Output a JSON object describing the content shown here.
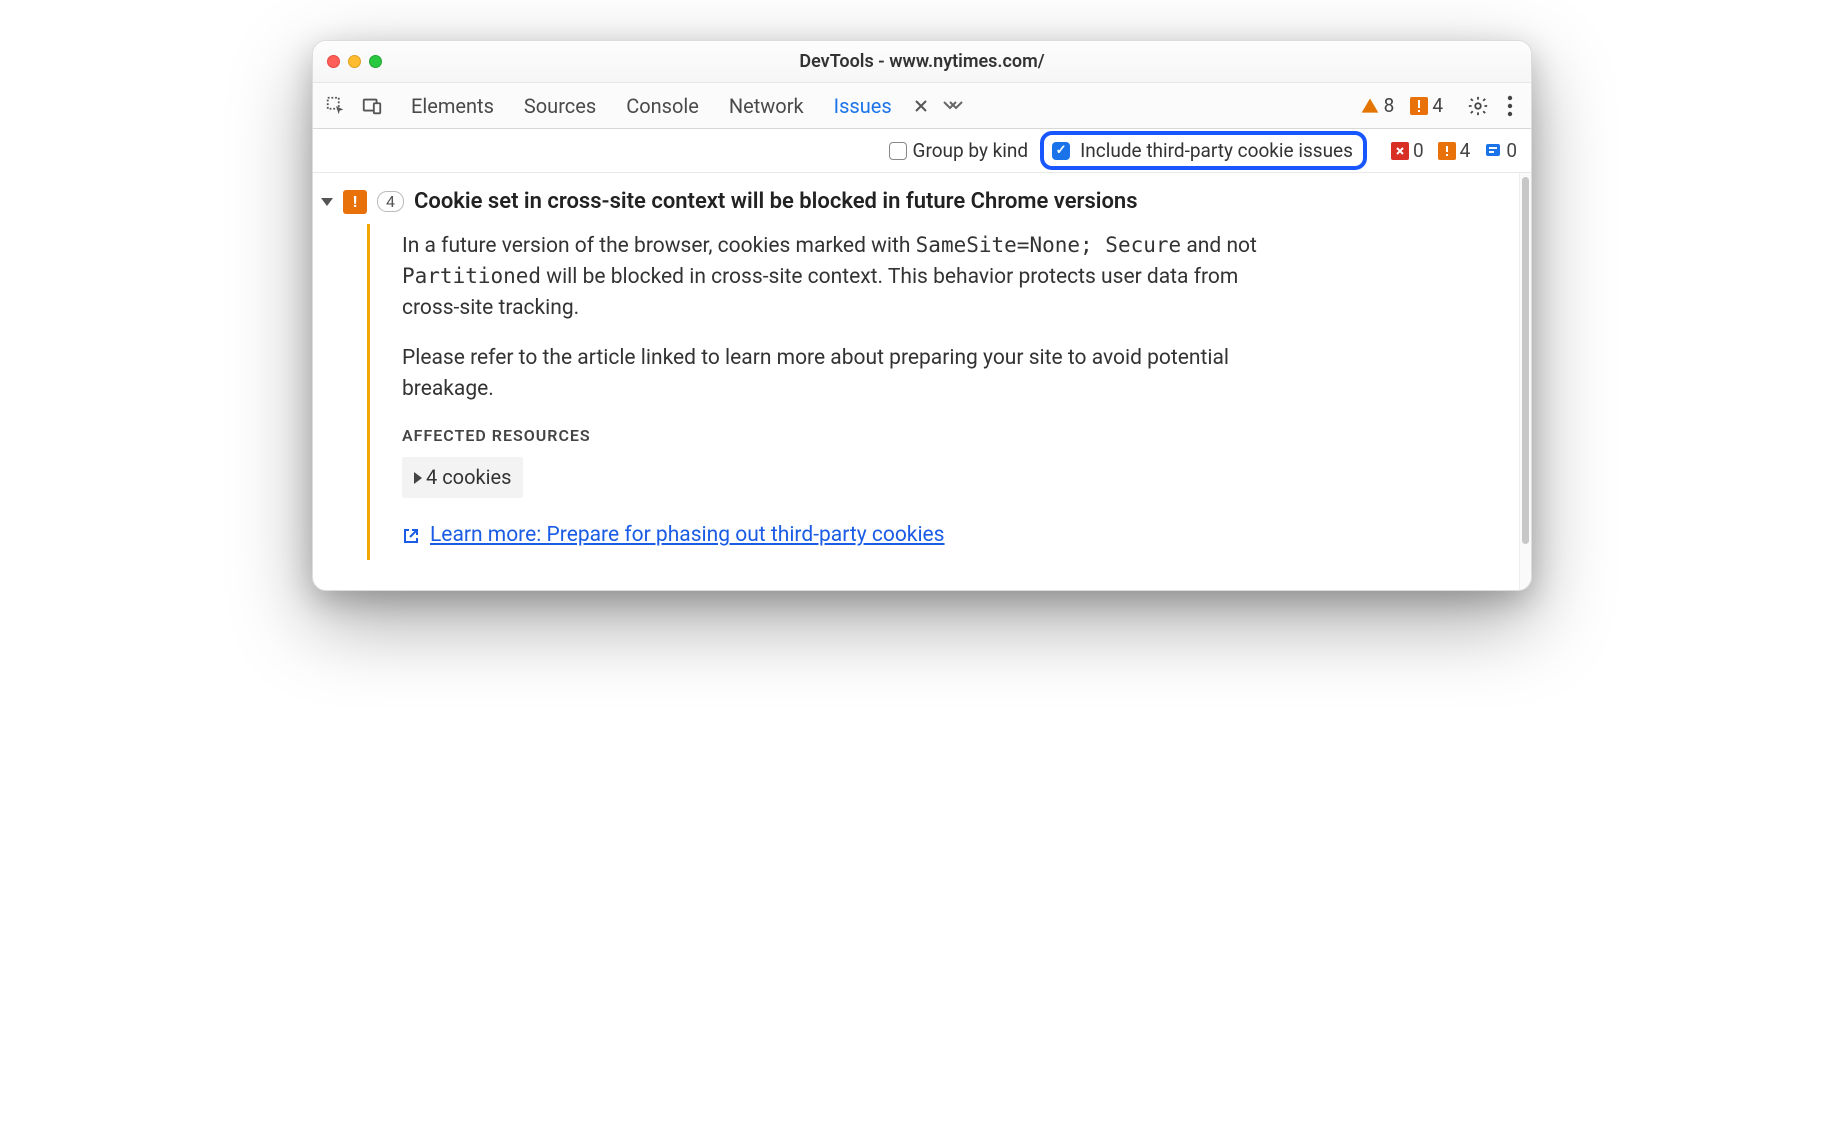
{
  "window": {
    "title": "DevTools - www.nytimes.com/"
  },
  "tabs": {
    "elements": "Elements",
    "sources": "Sources",
    "console": "Console",
    "network": "Network",
    "issues": "Issues"
  },
  "tabbar_stats": {
    "warnings": "8",
    "errors": "4"
  },
  "filter": {
    "group_by_kind": "Group by kind",
    "include_third_party": "Include third-party cookie issues"
  },
  "mini_stats": {
    "red": "0",
    "orange": "4",
    "blue": "0"
  },
  "issue": {
    "count": "4",
    "title": "Cookie set in cross-site context will be blocked in future Chrome versions",
    "body_1a": "In a future version of the browser, cookies marked with ",
    "body_1_code1": "SameSite=None; Secure",
    "body_1b": " and not ",
    "body_1_code2": "Partitioned",
    "body_1c": " will be blocked in cross-site context. This behavior protects user data from cross-site tracking.",
    "body_2": "Please refer to the article linked to learn more about preparing your site to avoid potential breakage.",
    "affected_label": "AFFECTED RESOURCES",
    "affected_cookies": "4 cookies",
    "learn_more": "Learn more: Prepare for phasing out third-party cookies"
  }
}
